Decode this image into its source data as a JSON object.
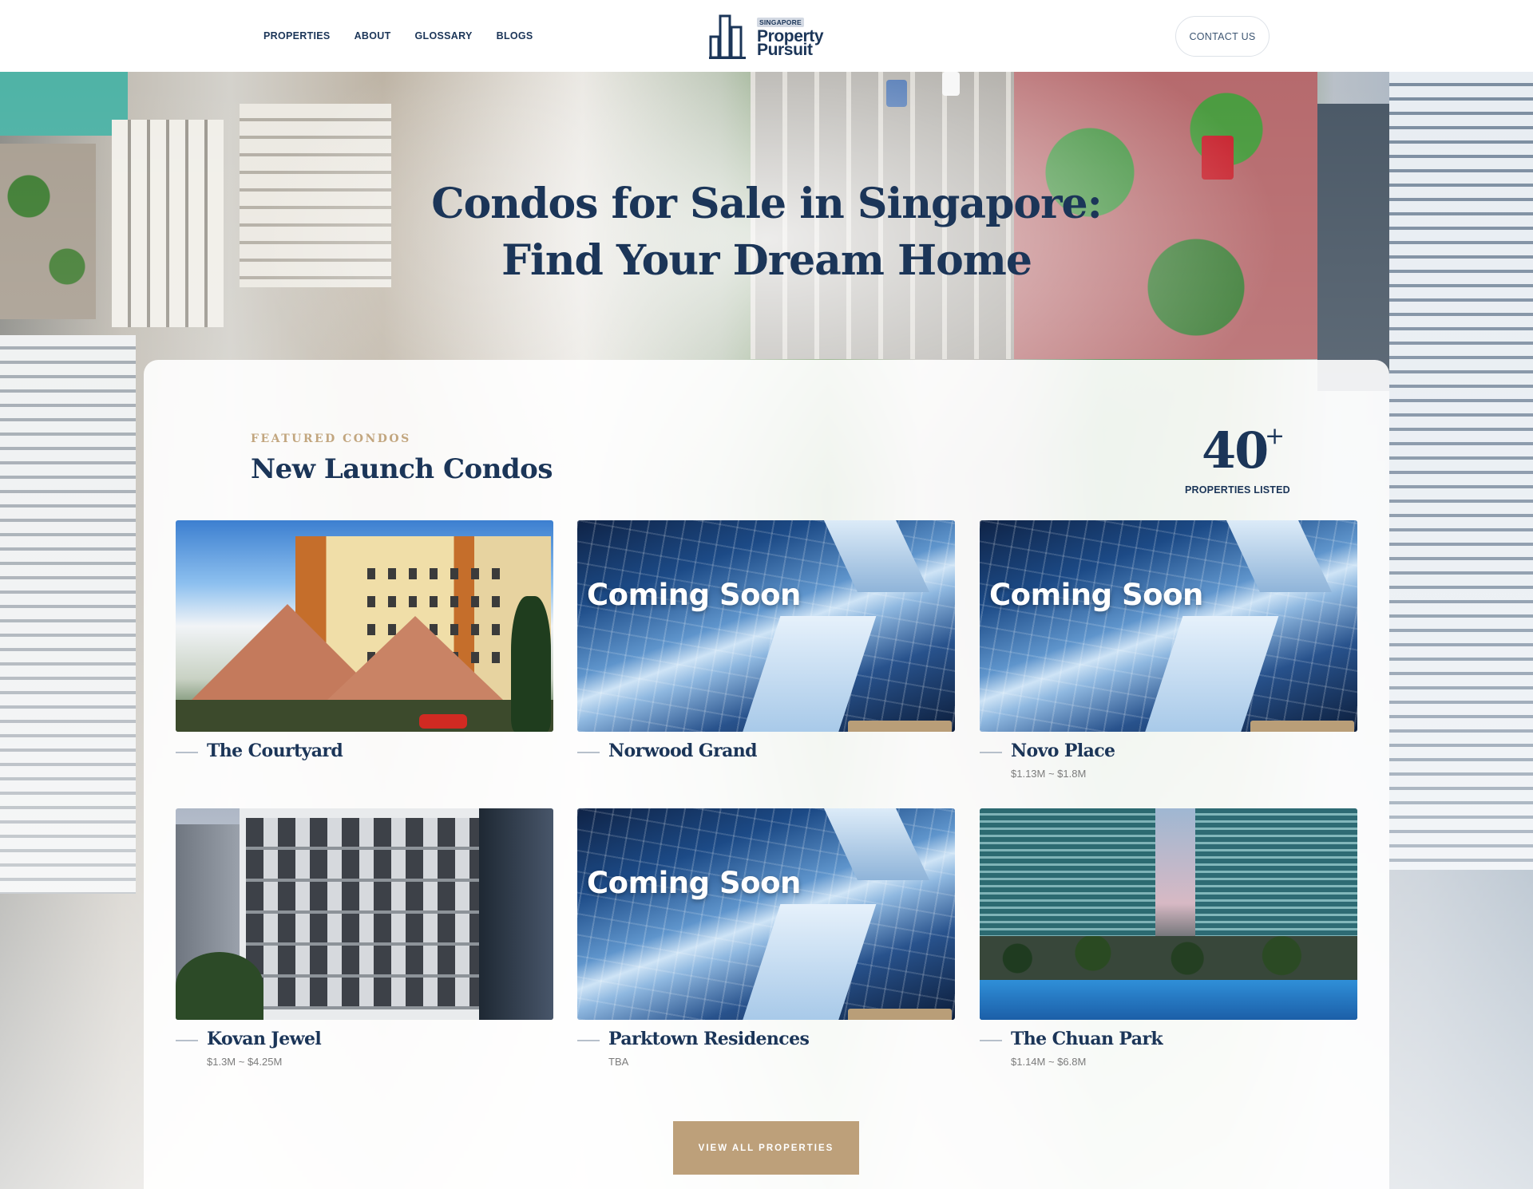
{
  "nav": {
    "items": [
      {
        "label": "PROPERTIES"
      },
      {
        "label": "ABOUT"
      },
      {
        "label": "GLOSSARY"
      },
      {
        "label": "BLOGS"
      }
    ]
  },
  "logo": {
    "tag": "SINGAPORE",
    "line1": "Property",
    "line2": "Pursuit"
  },
  "header": {
    "contact_label": "CONTACT US"
  },
  "hero": {
    "title": "Condos for Sale in Singapore: Find Your Dream Home"
  },
  "featured": {
    "eyebrow": "FEATURED CONDOS",
    "title": "New Launch Condos",
    "stat_number": "40",
    "stat_suffix": "+",
    "stat_label": "PROPERTIES LISTED"
  },
  "listings": [
    {
      "name": "The Courtyard",
      "price": "",
      "overlay": ""
    },
    {
      "name": "Norwood Grand",
      "price": "",
      "overlay": "Coming Soon"
    },
    {
      "name": "Novo Place",
      "price": "$1.13M ~ $1.8M",
      "overlay": "Coming Soon"
    },
    {
      "name": "Kovan Jewel",
      "price": "$1.3M ~ $4.25M",
      "overlay": ""
    },
    {
      "name": "Parktown Residences",
      "price": "TBA",
      "overlay": "Coming Soon"
    },
    {
      "name": "The Chuan Park",
      "price": "$1.14M ~ $6.8M",
      "overlay": ""
    }
  ],
  "cta": {
    "label": "VIEW ALL PROPERTIES"
  },
  "colors": {
    "navy": "#1b3558",
    "gold": "#bda07a",
    "eyebrow_gold": "#c2a67f",
    "price_gray": "#7c7c7c"
  },
  "icons": {
    "logo": "building-logo-icon",
    "thumbnail_badge": "developer-badge"
  }
}
